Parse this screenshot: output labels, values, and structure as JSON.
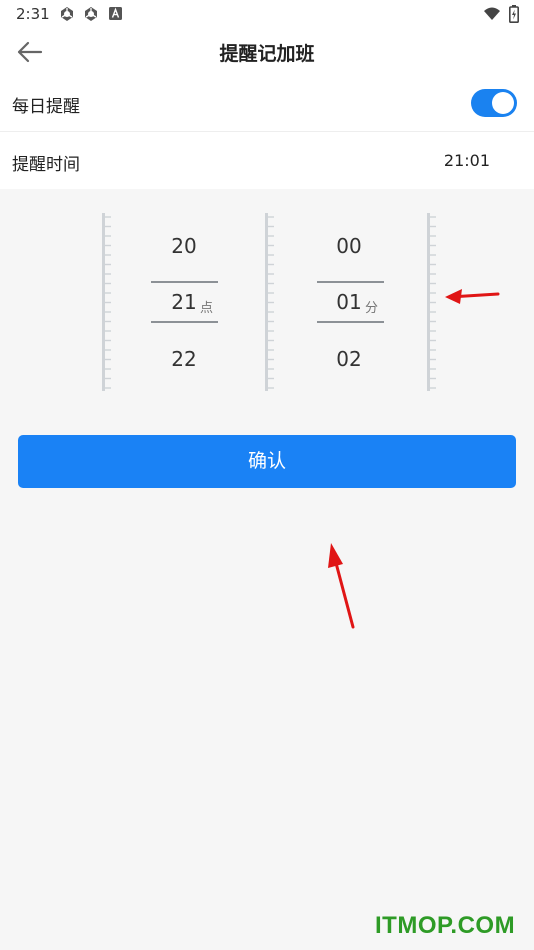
{
  "status_bar": {
    "time": "2:31",
    "left_icons": [
      "app-notification-icon",
      "app-notification-icon",
      "text-a-icon"
    ],
    "right_icons": [
      "wifi-icon",
      "battery-icon"
    ]
  },
  "header": {
    "title": "提醒记加班",
    "back_icon": "arrow-left-icon"
  },
  "settings": {
    "daily_reminder": {
      "label": "每日提醒",
      "enabled": true
    },
    "reminder_time": {
      "label": "提醒时间",
      "value": "21:01"
    }
  },
  "time_picker": {
    "hour": {
      "above": "20",
      "selected": "21",
      "below": "22",
      "unit": "点"
    },
    "minute": {
      "above": "00",
      "selected": "01",
      "below": "02",
      "unit": "分"
    }
  },
  "confirm_button": {
    "label": "确认"
  },
  "watermark": {
    "text": "ITMOP.COM"
  },
  "colors": {
    "accent": "#1a82f5",
    "annotation_arrow": "#e01515",
    "watermark": "#2e9b26",
    "background": "#f6f6f6"
  }
}
